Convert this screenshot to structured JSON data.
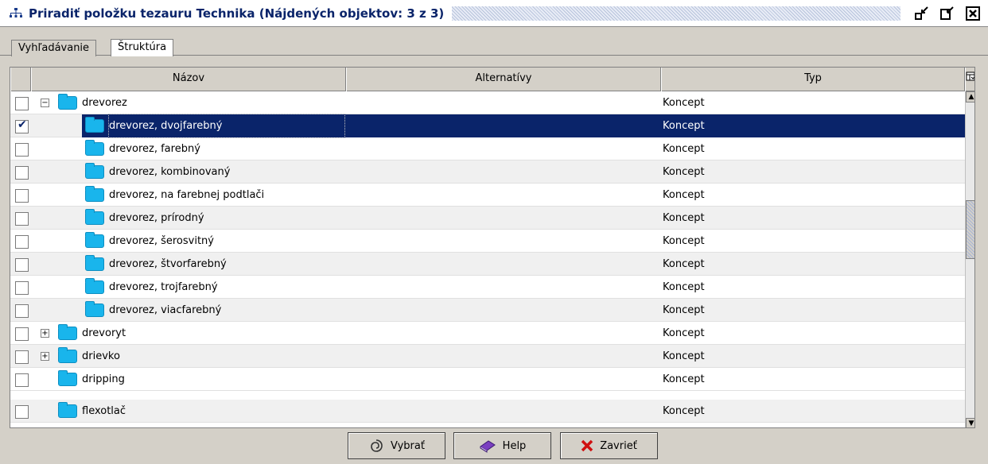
{
  "window": {
    "title": "Priradiť  položku tezauru Technika (Nájdených objektov: 3 z 3)"
  },
  "tabs": [
    {
      "label": "Vyhľadávanie"
    },
    {
      "label": "Štruktúra"
    }
  ],
  "columns": [
    "Názov",
    "Alternatívy",
    "Typ"
  ],
  "rows": [
    {
      "name": "drevorez",
      "type": "Koncept",
      "checked": false,
      "expand": "−",
      "level": 0
    },
    {
      "name": "drevorez, dvojfarebný",
      "type": "Koncept",
      "checked": true,
      "level": 1
    },
    {
      "name": "drevorez, farebný",
      "type": "Koncept",
      "checked": false,
      "level": 1
    },
    {
      "name": "drevorez, kombinovaný",
      "type": "Koncept",
      "checked": false,
      "level": 1
    },
    {
      "name": "drevorez, na farebnej podtlači",
      "type": "Koncept",
      "checked": false,
      "level": 1
    },
    {
      "name": "drevorez, prírodný",
      "type": "Koncept",
      "checked": false,
      "level": 1
    },
    {
      "name": "drevorez, šerosvitný",
      "type": "Koncept",
      "checked": false,
      "level": 1
    },
    {
      "name": "drevorez, štvorfarebný",
      "type": "Koncept",
      "checked": false,
      "level": 1
    },
    {
      "name": "drevorez, trojfarebný",
      "type": "Koncept",
      "checked": false,
      "level": 1
    },
    {
      "name": "drevorez, viacfarebný",
      "type": "Koncept",
      "checked": false,
      "level": 1
    },
    {
      "name": "drevoryt",
      "type": "Koncept",
      "checked": false,
      "expand": "+",
      "level": 0
    },
    {
      "name": "drievko",
      "type": "Koncept",
      "checked": false,
      "expand": "+",
      "level": 0
    },
    {
      "name": "dripping",
      "type": "Koncept",
      "checked": false,
      "level": 0
    },
    {
      "name": "flexotlač",
      "type": "Koncept",
      "checked": false,
      "level": 0
    }
  ],
  "buttons": {
    "select": "Vybrať",
    "help": "Help",
    "close": "Zavrieť"
  },
  "colors": {
    "selection": "#0a246a",
    "folder": "#19b5ec",
    "title_text": "#0a246a"
  }
}
